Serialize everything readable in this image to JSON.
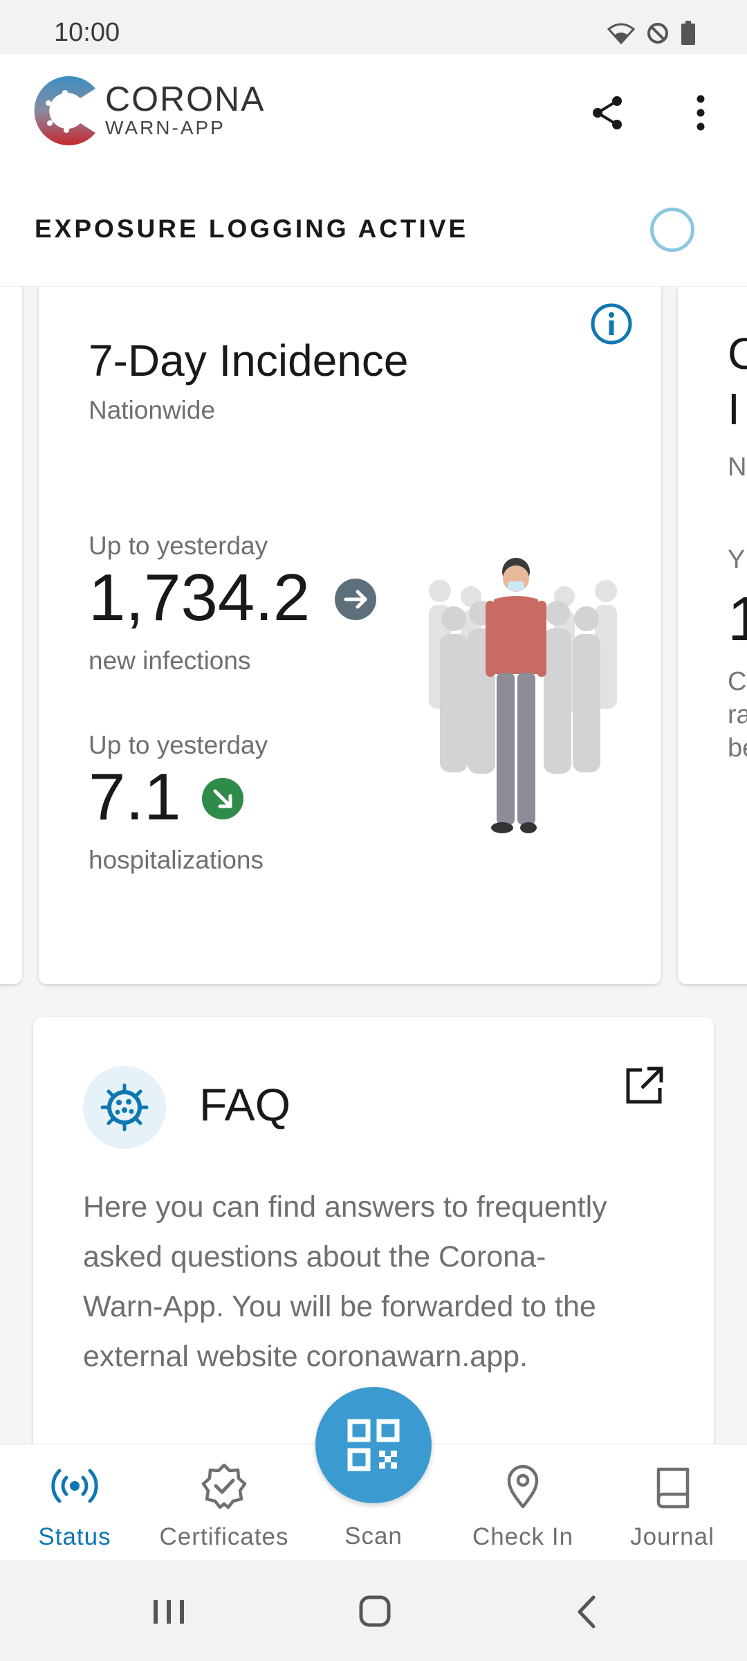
{
  "status_bar": {
    "time": "10:00",
    "icons": [
      "wifi-icon",
      "do-not-disturb-icon",
      "battery-icon"
    ]
  },
  "app": {
    "title": "CORONA",
    "subtitle": "WARN-APP",
    "actions": [
      "share-icon",
      "more-vert-icon"
    ]
  },
  "exposure": {
    "label": "EXPOSURE LOGGING ACTIVE",
    "status_color": "#8cc7e0"
  },
  "incidence_card": {
    "title": "7-Day Incidence",
    "subtitle": "Nationwide",
    "metrics": [
      {
        "label": "Up to yesterday",
        "value": "1,734.2",
        "unit": "new infections",
        "trend": "stable",
        "trend_color": "#5e6f7c"
      },
      {
        "label": "Up to yesterday",
        "value": "7.1",
        "unit": "hospitalizations",
        "trend": "decreasing",
        "trend_color": "#2f8b4a"
      }
    ]
  },
  "next_card_fragment": {
    "title_lines": [
      "C",
      "I"
    ],
    "sub": "N",
    "label": "Y",
    "value": "1",
    "desc_lines": [
      "C",
      "ra",
      "be"
    ]
  },
  "faq": {
    "title": "FAQ",
    "body": "Here you can find answers to frequently asked questions about the Corona-Warn-App. You will be forwarded to the external website coronawarn.app."
  },
  "nav": {
    "items": [
      {
        "label": "Status",
        "icon": "status-broadcast-icon",
        "active": true
      },
      {
        "label": "Certificates",
        "icon": "certificate-badge-icon",
        "active": false
      },
      {
        "label": "Scan",
        "icon": "qr-code-icon",
        "active": false
      },
      {
        "label": "Check In",
        "icon": "location-pin-icon",
        "active": false
      },
      {
        "label": "Journal",
        "icon": "journal-book-icon",
        "active": false
      }
    ]
  },
  "colors": {
    "accent": "#0f77b3",
    "fab": "#3b9bd0",
    "text": "#17191a",
    "muted": "#6f6f6f"
  }
}
